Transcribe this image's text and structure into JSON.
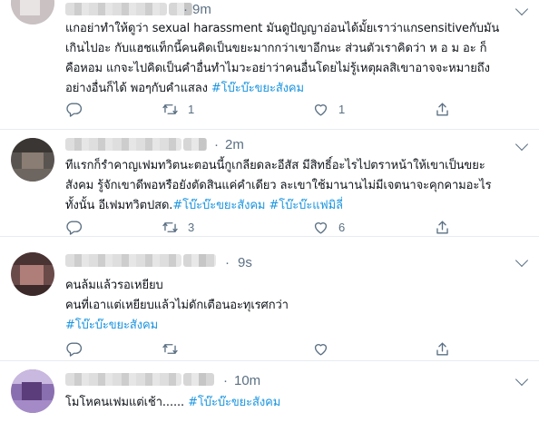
{
  "tweets": [
    {
      "time": "9m",
      "text_pre": "แกอย่าทำให้ดูว่า sexual harassment มันดูปัญญาอ่อนได้มั้ยเราว่าแกsensitiveกับมัน\nเกินไปอะ กับแฮชแท็กนี้คนคิดเป็นขยะมากกว่าเขาอีกนะ ส่วนตัวเราคิดว่า ห อ ม อะ ก็\nคือหอม แกจะไปคิดเป็นคำอื่นทำไมวะอย่าว่าคนอื่นโดยไม่รู้เหตุผลสิเขาอาจจะหมายถึง\nอย่างอื่นก็ได้ พอๆกับคำแสลง ",
      "hashtags": [
        "#โบ๊ะบ๊ะขยะสังคม"
      ],
      "reply_count": "",
      "retweet_count": "1",
      "like_count": "1"
    },
    {
      "time": "2m",
      "text_pre": "ทีแรกก็รำคาญเฟมทวิตนะตอนนี้กูเกลียดละอีสัส มีสิทธิ์อะไรไปตราหน้าให้เขาเป็นขยะ\nสังคม รู้จักเขาดีพอหรือยังตัดสินแค่คำเดียว ละเขาใช้มานานไม่มีเจตนาจะคุกคามอะไร\nทั้งนั้น อีเฟมทวิตปสด.",
      "hashtags": [
        "#โบ๊ะบ๊ะขยะสังคม",
        "#โบ๊ะบ๊ะแฟมิลี่"
      ],
      "reply_count": "",
      "retweet_count": "3",
      "like_count": "6"
    },
    {
      "time": "9s",
      "text_pre": "คนล้มแล้วรอเหยียบ\nคนที่เอาแต่เหยียบแล้วไม่ดักเตือนอะทุเรศกว่า\n",
      "hashtags": [
        "#โบ๊ะบ๊ะขยะสังคม"
      ],
      "reply_count": "",
      "retweet_count": "",
      "like_count": ""
    },
    {
      "time": "10m",
      "text_pre": "โมโหคนเฟมแต่เช้า...... ",
      "hashtags": [
        "#โบ๊ะบ๊ะขยะสังคม"
      ]
    }
  ],
  "icons": [
    "reply-icon",
    "retweet-icon",
    "like-icon",
    "share-icon",
    "chevron-down-icon"
  ],
  "colors": {
    "hashtag": "#1b95e0",
    "meta": "#5b7083",
    "divider": "#e6ecf0"
  }
}
